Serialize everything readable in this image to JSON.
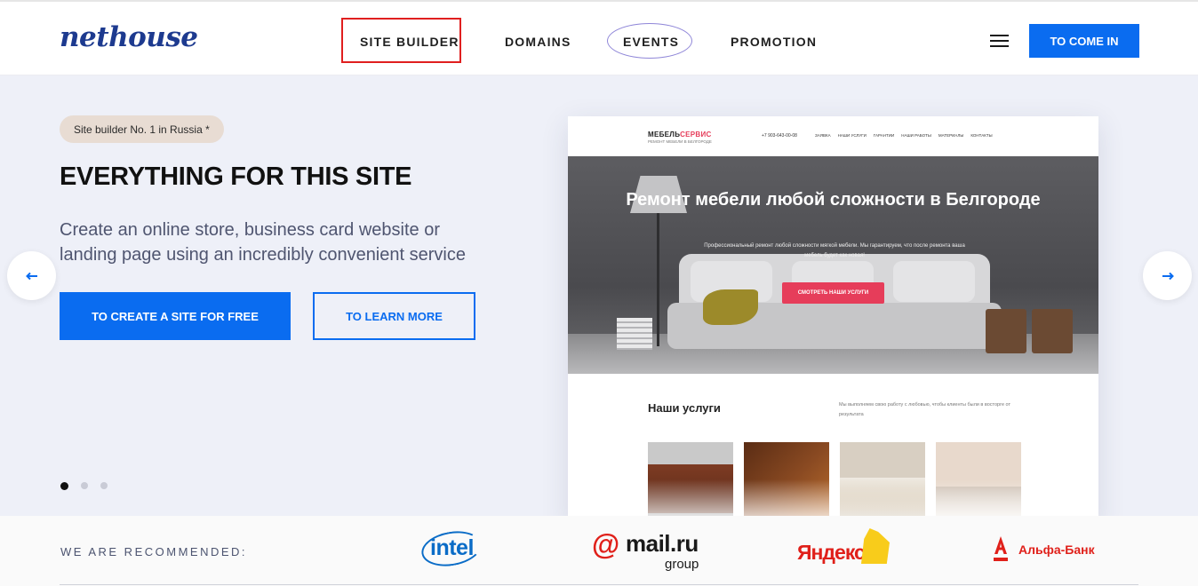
{
  "header": {
    "logo": "nethouse",
    "nav": [
      {
        "label": "SITE BUILDER"
      },
      {
        "label": "DOMAINS"
      },
      {
        "label": "EVENTS"
      },
      {
        "label": "PROMOTION"
      }
    ],
    "login_button": "TO COME IN",
    "accent_color": "#0a6cf0",
    "highlight_color": "#e01f1f"
  },
  "hero": {
    "badge": "Site builder No. 1 in Russia *",
    "title": "EVERYTHING FOR THIS SITE",
    "subtitle": "Create an online store, business card website or landing page using an incredibly convenient service",
    "primary_button": "TO CREATE A SITE FOR FREE",
    "secondary_button": "TO LEARN MORE",
    "slides_total": 3,
    "active_slide": 1
  },
  "preview": {
    "logo_main": "МЕБЕЛЬ",
    "logo_accent": "СЕРВИС",
    "logo_sub": "РЕМОНТ МЕБЕЛИ В БЕЛГОРОДЕ",
    "phone": "+7 903-643-00-08",
    "menu": [
      "ЗАЯВКА",
      "НАШИ УСЛУГИ",
      "ГАРАНТИИ",
      "НАШИ РАБОТЫ",
      "МАТЕРИАЛЫ",
      "КОНТАКТЫ"
    ],
    "title": "Ремонт мебели любой сложности в Белгороде",
    "text": "Профессиональный ремонт любой сложности мягкой мебели. Мы гарантируем, что после ремонта ваша мебель будет как новая!",
    "button": "СМОТРЕТЬ НАШИ УСЛУГИ",
    "services_title": "Наши услуги",
    "services_text": "Мы выполняем свою работу с любовью, чтобы клиенты были в восторге от результата"
  },
  "recommended": {
    "label": "WE ARE RECOMMENDED:",
    "brands": {
      "intel": "intel",
      "mailru": "mail.ru",
      "mailru_sub": "group",
      "yandex": "Яндекс",
      "alfa": "Альфа-Банк"
    }
  }
}
